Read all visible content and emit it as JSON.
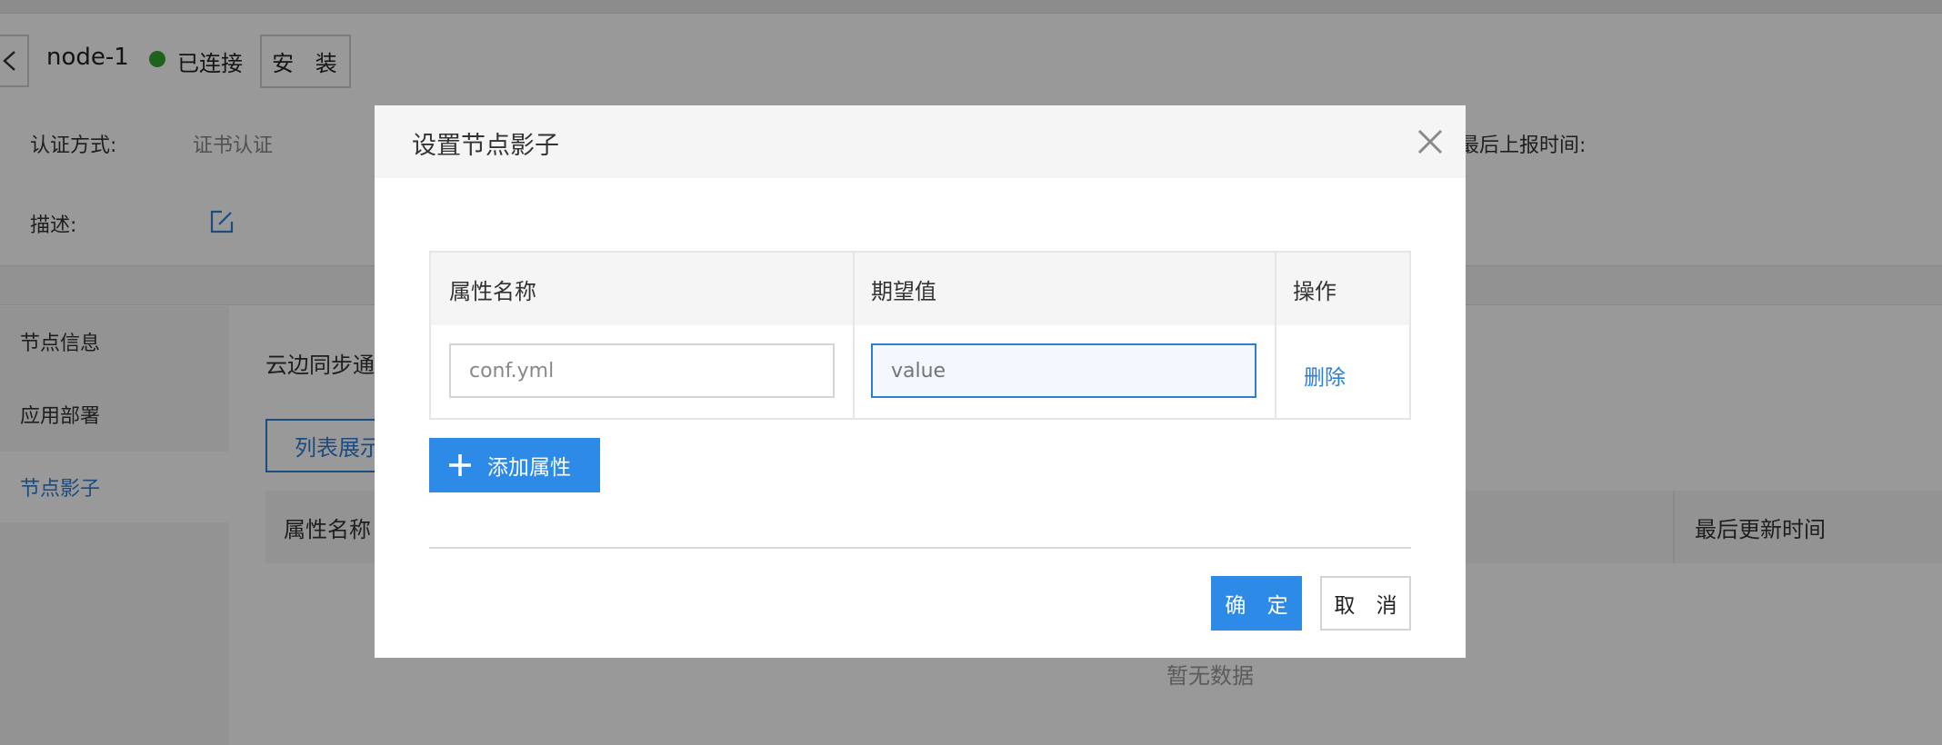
{
  "node": {
    "name": "node-1",
    "status_text": "已连接",
    "install_label": "安 装"
  },
  "info": {
    "auth_label": "认证方式:",
    "auth_value": "证书认证",
    "last_report_label": "最后上报时间:",
    "desc_label": "描述:"
  },
  "sidebar": {
    "items": [
      {
        "label": "节点信息"
      },
      {
        "label": "应用部署"
      },
      {
        "label": "节点影子"
      }
    ]
  },
  "main": {
    "sync_text": "云边同步通",
    "list_view_label": "列表展示",
    "table_headers": [
      "属性名称",
      "最后更新时间"
    ],
    "empty_text": "暂无数据"
  },
  "modal": {
    "title": "设置节点影子",
    "columns": [
      "属性名称",
      "期望值",
      "操作"
    ],
    "rows": [
      {
        "name_value": "conf.yml",
        "value_placeholder": "value",
        "action_label": "删除"
      }
    ],
    "add_label": "添加属性",
    "confirm_label": "确 定",
    "cancel_label": "取 消"
  },
  "colors": {
    "primary": "#2d8ae6",
    "link": "#2d7fd6",
    "status_online": "#31a531"
  }
}
